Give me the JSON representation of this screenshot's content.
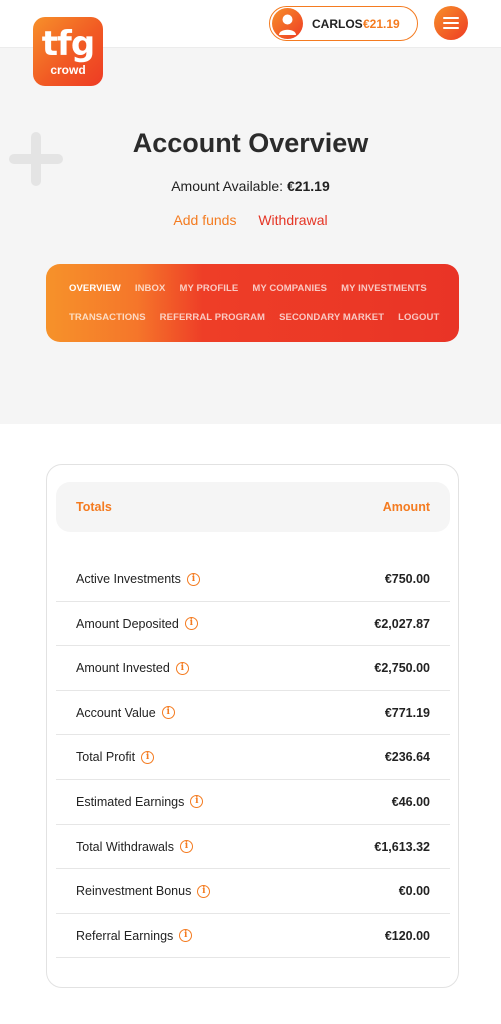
{
  "brand": {
    "logo_main": "tfg",
    "logo_sub": "crowd",
    "accent": "#f47b20",
    "accent_red": "#e53525"
  },
  "user": {
    "name": "CARLOS",
    "balance": "€21.19",
    "avatar_icon": "user-avatar-icon"
  },
  "header": {
    "menu_icon": "hamburger-menu-icon"
  },
  "page": {
    "title": "Account Overview",
    "available_label": "Amount Available:",
    "available_value": "€21.19",
    "add_funds": "Add funds",
    "withdrawal": "Withdrawal"
  },
  "nav": {
    "row1": [
      "OVERVIEW",
      "INBOX",
      "MY PROFILE",
      "MY COMPANIES",
      "MY INVESTMENTS"
    ],
    "row2": [
      "TRANSACTIONS",
      "REFERRAL PROGRAM",
      "SECONDARY MARKET",
      "LOGOUT"
    ],
    "active": "OVERVIEW"
  },
  "table": {
    "headers": {
      "label": "Totals",
      "amount": "Amount"
    },
    "rows": [
      {
        "label": "Active Investments",
        "value": "€750.00"
      },
      {
        "label": "Amount Deposited",
        "value": "€2,027.87"
      },
      {
        "label": "Amount Invested",
        "value": "€2,750.00"
      },
      {
        "label": "Account Value",
        "value": "€771.19"
      },
      {
        "label": "Total Profit",
        "value": "€236.64"
      },
      {
        "label": "Estimated Earnings",
        "value": "€46.00"
      },
      {
        "label": "Total Withdrawals",
        "value": "€1,613.32"
      },
      {
        "label": "Reinvestment Bonus",
        "value": "€0.00"
      },
      {
        "label": "Referral Earnings",
        "value": "€120.00"
      }
    ]
  }
}
